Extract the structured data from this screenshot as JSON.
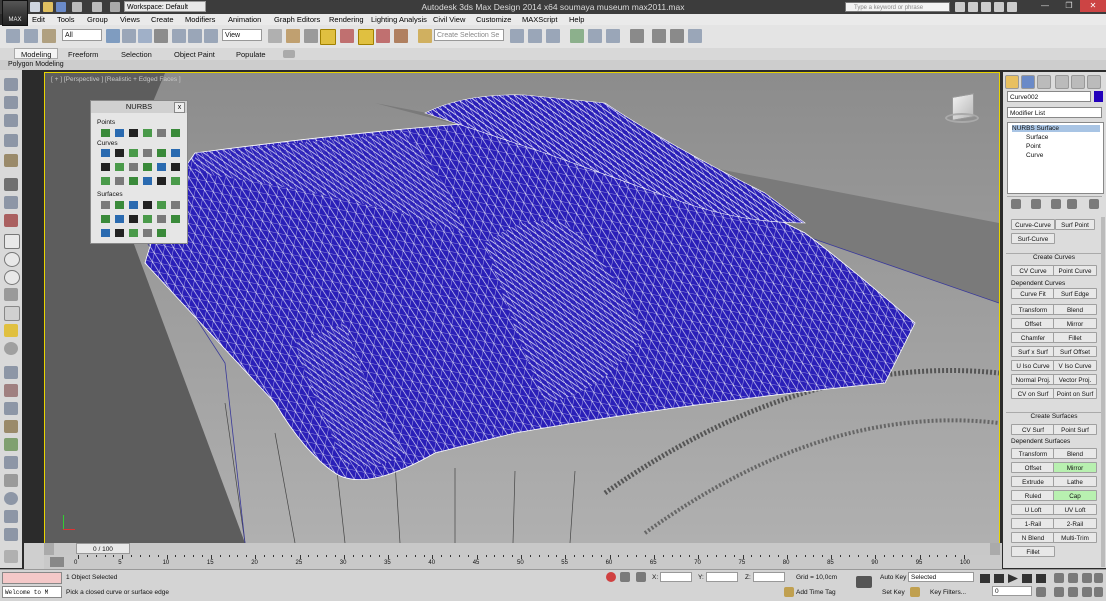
{
  "app": {
    "title": "Autodesk 3ds Max Design 2014 x64     soumaya museum max2011.max",
    "logo_text": "MAX",
    "workspace": "Workspace: Default",
    "search_placeholder": "Type a keyword or phrase",
    "minimize": "—",
    "maximize": "❐",
    "close": "✕"
  },
  "menu": [
    "Edit",
    "Tools",
    "Group",
    "Views",
    "Create",
    "Modifiers",
    "Animation",
    "Graph Editors",
    "Rendering",
    "Lighting Analysis",
    "Civil View",
    "Customize",
    "MAXScript",
    "Help"
  ],
  "toolbar": {
    "selection_filter": "All",
    "reference_coord": "View",
    "named_selection_placeholder": "Create Selection Se"
  },
  "ribbon": {
    "tabs": [
      "Modeling",
      "Freeform",
      "Selection",
      "Object Paint",
      "Populate"
    ],
    "active": "Modeling",
    "subpanel": "Polygon Modeling"
  },
  "viewport": {
    "label": "[ + ] [Perspective ] [Realistic + Edged Faces ]",
    "mesh_color": "#2a1fb8",
    "border_color": "#e8d400"
  },
  "nurbs_panel": {
    "title": "NURBS",
    "close": "x",
    "sections": [
      "Points",
      "Curves",
      "Surfaces"
    ]
  },
  "command_panel": {
    "object_name": "Curve002",
    "object_color": "#2200bb",
    "modifier_list": "Modifier List",
    "stack": {
      "root": "NURBS Surface",
      "children": [
        "Surface",
        "Point",
        "Curve"
      ]
    },
    "top_buttons": [
      "Curve-Curve",
      "Surf Point",
      "Surf-Curve"
    ],
    "create_curves": {
      "title": "Create Curves",
      "main": [
        "CV Curve",
        "Point Curve"
      ],
      "dependent_title": "Dependent Curves",
      "dependent": [
        "Curve Fit",
        "Surf Edge",
        "Transform",
        "Blend",
        "Offset",
        "Mirror",
        "Chamfer",
        "Fillet",
        "Surf x Surf",
        "Surf Offset",
        "U Iso Curve",
        "V Iso Curve",
        "Normal Proj.",
        "Vector Proj.",
        "CV on Surf",
        "Point on Surf"
      ]
    },
    "create_surfaces": {
      "title": "Create Surfaces",
      "main": [
        "CV Surf",
        "Point Surf"
      ],
      "dependent_title": "Dependent Surfaces",
      "dependent": [
        "Transform",
        "Blend",
        "Offset",
        "Mirror",
        "Extrude",
        "Lathe",
        "Ruled",
        "Cap",
        "U Loft",
        "UV Loft",
        "1-Rail",
        "2-Rail",
        "N Blend",
        "Multi-Trim",
        "Fillet"
      ],
      "highlighted": [
        "Mirror",
        "Cap"
      ]
    }
  },
  "timeline": {
    "frame_label": "0 / 100",
    "ticks": [
      "0",
      "5",
      "10",
      "15",
      "20",
      "25",
      "30",
      "35",
      "40",
      "45",
      "50",
      "55",
      "60",
      "65",
      "70",
      "75",
      "80",
      "85",
      "90",
      "95",
      "100"
    ]
  },
  "status": {
    "script_listener": "Welcome to M",
    "selection": "1 Object Selected",
    "prompt": "Pick a closed curve or surface edge",
    "x_label": "X:",
    "y_label": "Y:",
    "z_label": "Z:",
    "x_value": "",
    "y_value": "",
    "z_value": "",
    "grid": "Grid = 10,0cm",
    "add_time_tag": "Add Time Tag",
    "auto_key": "Auto Key",
    "set_key": "Set Key",
    "key_mode": "Selected",
    "key_filters": "Key Filters...",
    "current_frame": "0"
  }
}
